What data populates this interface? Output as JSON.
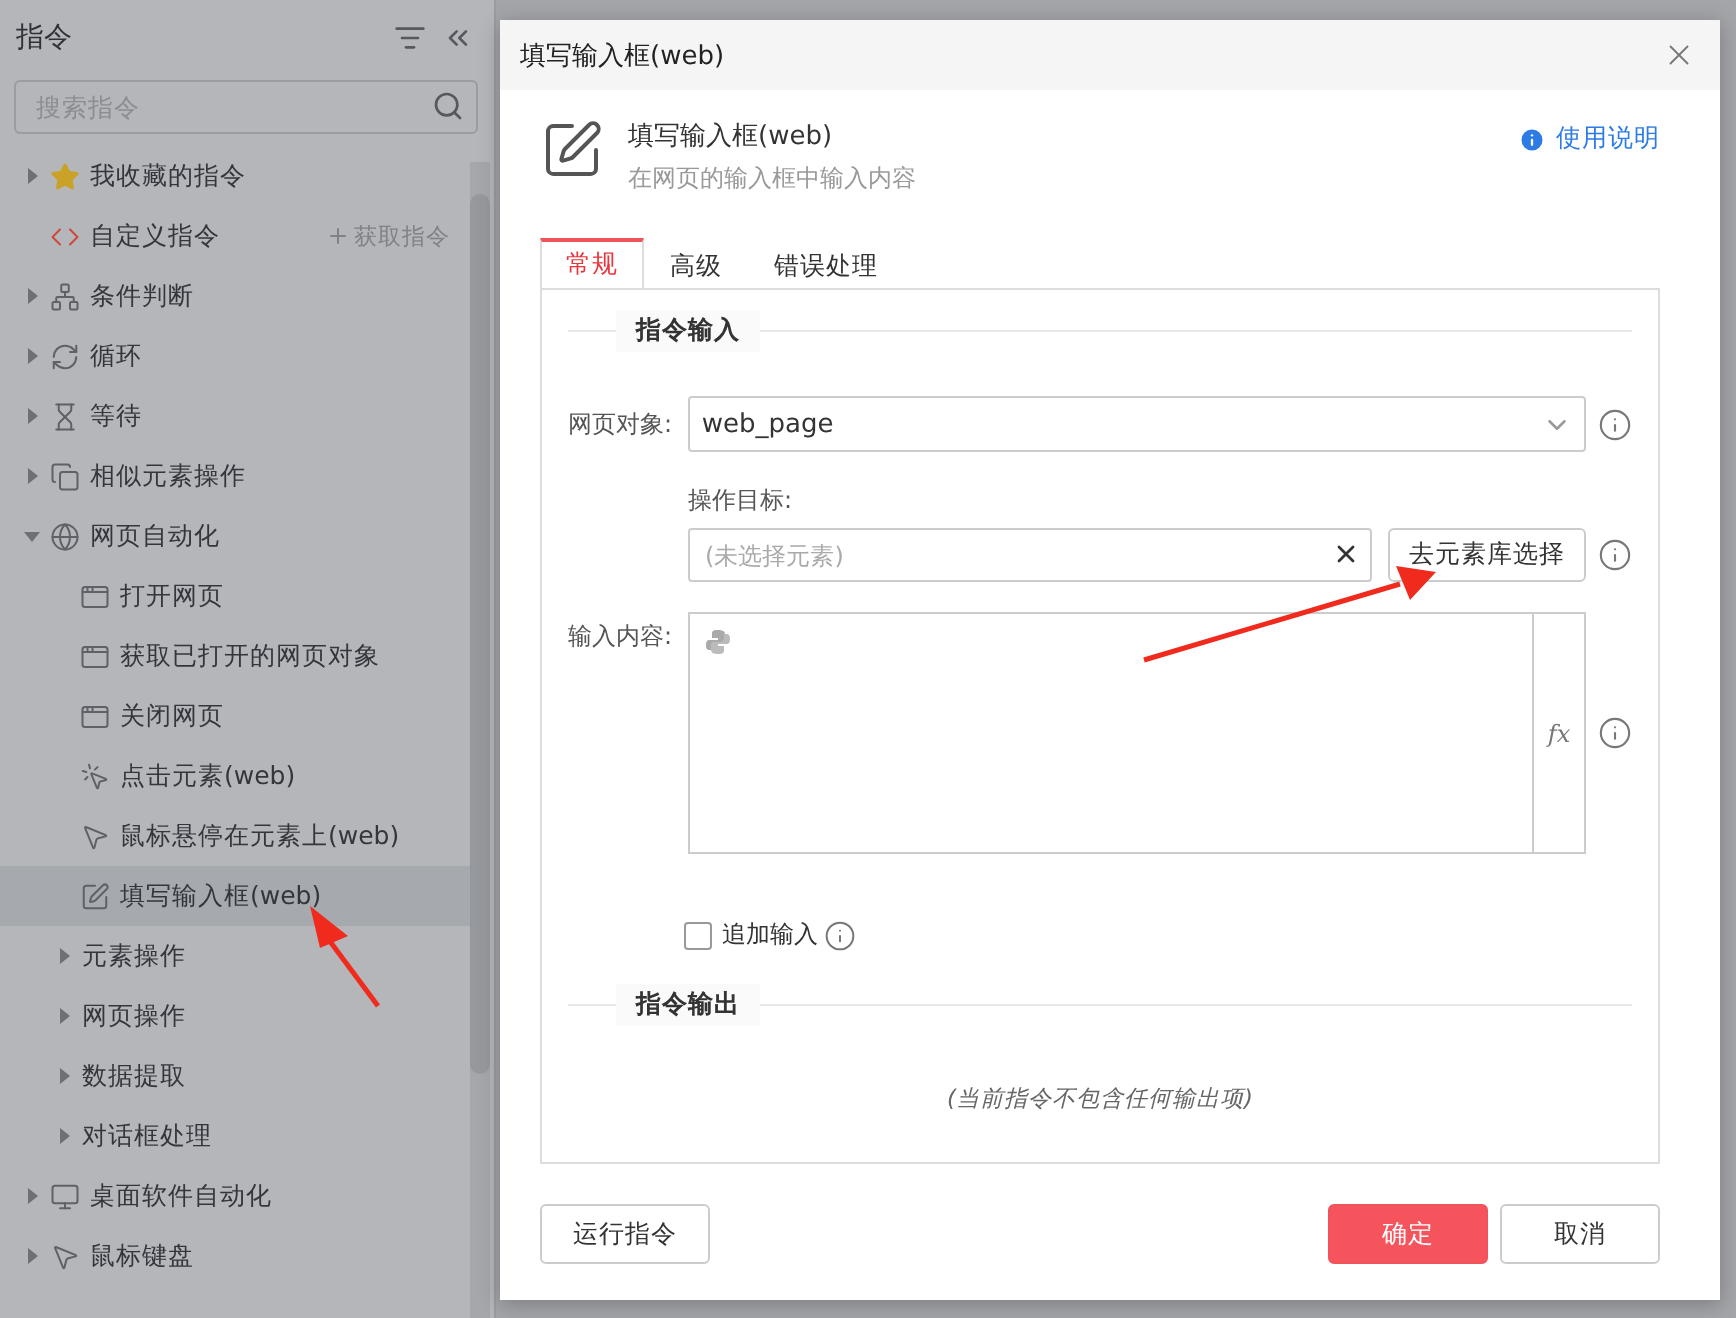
{
  "sidebar": {
    "title": "指令",
    "search": {
      "placeholder": "搜索指令"
    },
    "items": [
      {
        "label": "我收藏的指令",
        "kind": "favorites",
        "expanded": false,
        "selected": false
      },
      {
        "label": "自定义指令",
        "kind": "custom",
        "selected": false,
        "action": "获取指令"
      },
      {
        "label": "条件判断",
        "kind": "condition",
        "expanded": false,
        "selected": false
      },
      {
        "label": "循环",
        "kind": "loop",
        "expanded": false,
        "selected": false
      },
      {
        "label": "等待",
        "kind": "wait",
        "expanded": false,
        "selected": false
      },
      {
        "label": "相似元素操作",
        "kind": "similar",
        "expanded": false,
        "selected": false
      },
      {
        "label": "网页自动化",
        "kind": "web",
        "expanded": true,
        "selected": false,
        "children": [
          {
            "label": "打开网页",
            "kind": "page",
            "selected": false
          },
          {
            "label": "获取已打开的网页对象",
            "kind": "page",
            "selected": false
          },
          {
            "label": "关闭网页",
            "kind": "page",
            "selected": false
          },
          {
            "label": "点击元素(web)",
            "kind": "click",
            "selected": false
          },
          {
            "label": "鼠标悬停在元素上(web)",
            "kind": "hover",
            "selected": false
          },
          {
            "label": "填写输入框(web)",
            "kind": "fill",
            "selected": true
          },
          {
            "label": "元素操作",
            "kind": "folder",
            "expanded": false,
            "selected": false
          },
          {
            "label": "网页操作",
            "kind": "folder",
            "expanded": false,
            "selected": false
          },
          {
            "label": "数据提取",
            "kind": "folder",
            "expanded": false,
            "selected": false
          },
          {
            "label": "对话框处理",
            "kind": "folder",
            "expanded": false,
            "selected": false
          }
        ]
      },
      {
        "label": "桌面软件自动化",
        "kind": "desktop",
        "expanded": false,
        "selected": false
      },
      {
        "label": "鼠标键盘",
        "kind": "mouse",
        "expanded": false,
        "selected": false
      }
    ]
  },
  "dialog": {
    "title": "填写输入框(web)",
    "command": {
      "name": "填写输入框(web)",
      "description": "在网页的输入框中输入内容",
      "help": "使用说明"
    },
    "tabs": [
      {
        "label": "常规",
        "selected": true
      },
      {
        "label": "高级",
        "selected": false
      },
      {
        "label": "错误处理",
        "selected": false
      }
    ],
    "input_section": "指令输入",
    "web_object": {
      "label": "网页对象:",
      "value": "web_page"
    },
    "target": {
      "label": "操作目标:",
      "placeholder": "(未选择元素)",
      "button": "去元素库选择"
    },
    "content": {
      "label": "输入内容:",
      "fx": "fx"
    },
    "append": {
      "label": "追加输入",
      "checked": false
    },
    "output_section": "指令输出",
    "output_note": "(当前指令不包含任何输出项)",
    "buttons": {
      "run": "运行指令",
      "ok": "确定",
      "cancel": "取消"
    }
  }
}
